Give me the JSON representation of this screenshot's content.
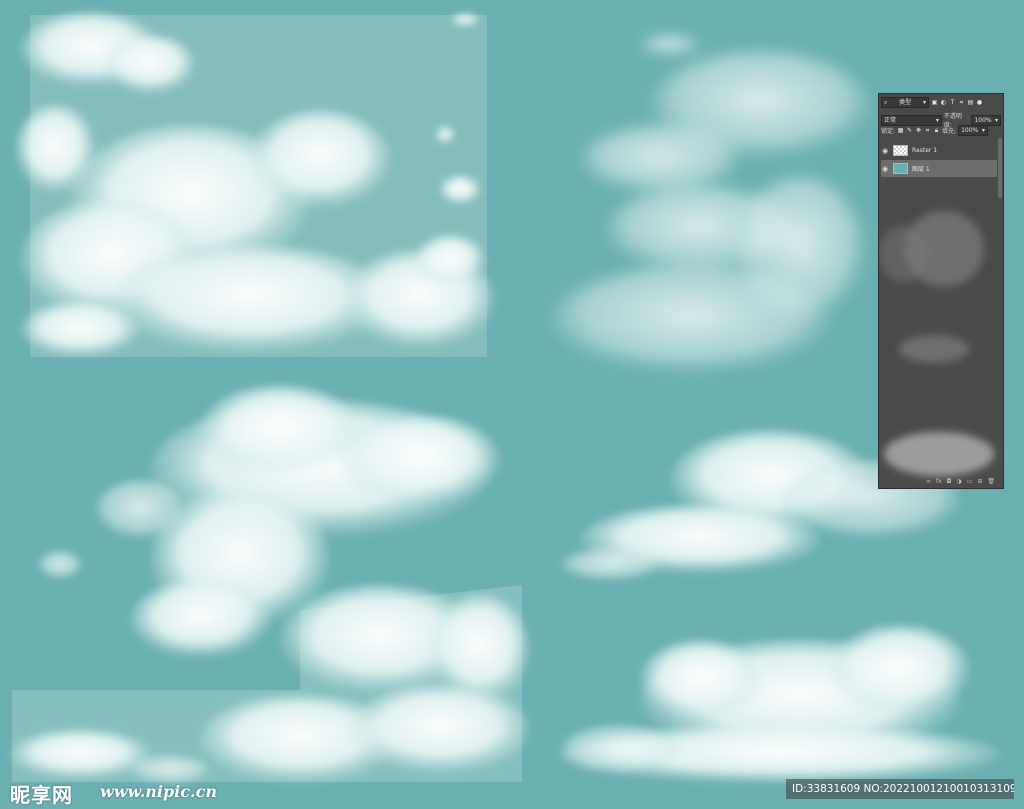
{
  "colors": {
    "background": "#6aafb1",
    "cloud": "#f2fbfa",
    "panel": "#4a4a4a"
  },
  "layers_panel": {
    "kind_filter": "类型",
    "blend_mode": "正常",
    "opacity_label": "不透明度:",
    "opacity_value": "100%",
    "lock_label": "锁定:",
    "fill_label": "填充:",
    "fill_value": "100%",
    "layers": [
      {
        "name": "Raster 1",
        "visible": true,
        "selected": false,
        "thumb": "checker"
      },
      {
        "name": "图层 1",
        "visible": true,
        "selected": true,
        "thumb": "teal"
      }
    ],
    "filter_icons": [
      "image-filter-icon",
      "adjustment-filter-icon",
      "type-filter-icon",
      "shape-filter-icon",
      "smart-object-filter-icon",
      "filter-toggle-icon"
    ],
    "lock_icons": [
      "lock-transparent-icon",
      "lock-paint-icon",
      "lock-move-icon",
      "lock-artboard-icon",
      "lock-all-icon"
    ],
    "footer_icons": [
      "link-layers-icon",
      "fx-icon",
      "add-mask-icon",
      "new-adjustment-icon",
      "new-group-icon",
      "new-layer-icon",
      "delete-layer-icon"
    ]
  },
  "watermark": {
    "logo": "昵享网",
    "url": "www.nipic.cn",
    "id_text": "ID:33831609 NO:20221001210010313109"
  }
}
